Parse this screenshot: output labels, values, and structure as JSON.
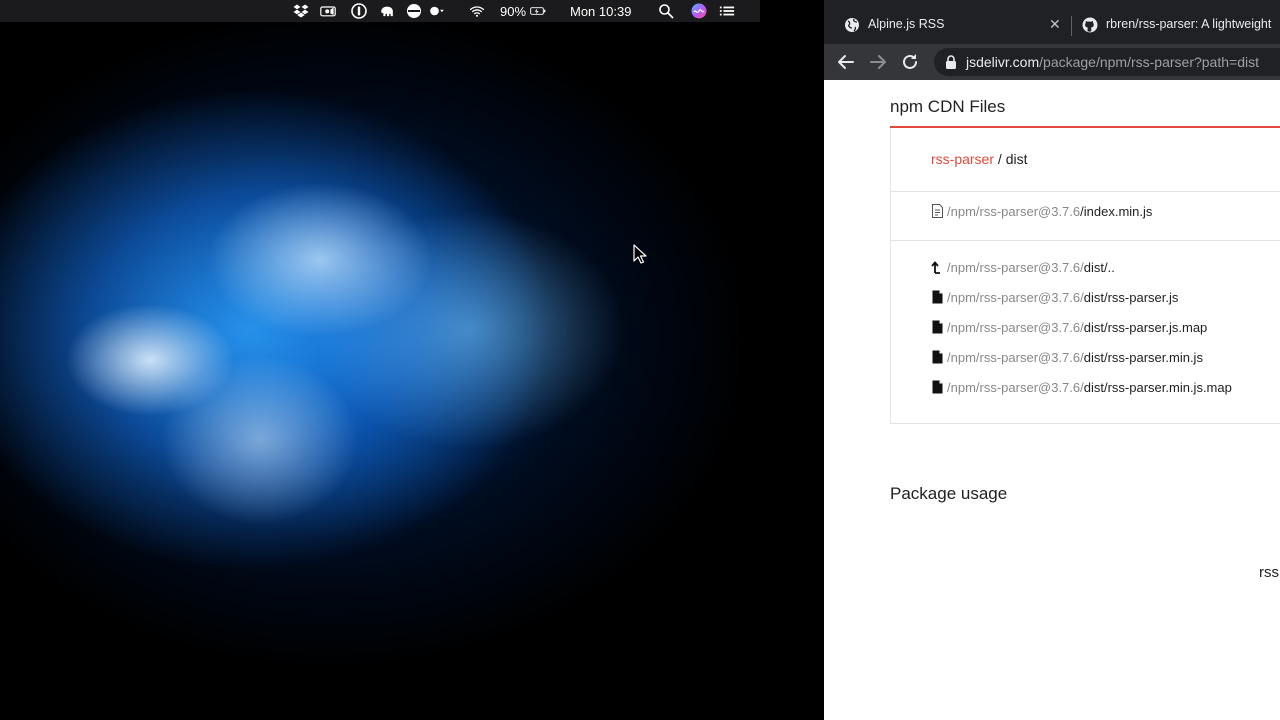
{
  "menubar": {
    "battery_percent": "90%",
    "clock": "Mon 10:39",
    "icons": [
      "dropbox-icon",
      "screen-record-icon",
      "onepassword-icon",
      "elephant-icon",
      "bartender-icon",
      "moon-icon",
      "wifi-icon",
      "battery-charging-icon",
      "search-icon",
      "siri-icon",
      "control-list-icon"
    ]
  },
  "browser": {
    "tabs": [
      {
        "title": "Alpine.js RSS",
        "favicon": "globe-icon",
        "active": true
      },
      {
        "title": "rbren/rss-parser: A lightweight",
        "favicon": "github-icon",
        "active": false
      }
    ],
    "url_host": "jsdelivr.com",
    "url_path": "/package/npm/rss-parser?path=dist"
  },
  "page": {
    "files_title": "npm CDN Files",
    "breadcrumb": {
      "package": "rss-parser",
      "separator": " / ",
      "folder": "dist"
    },
    "default_file": {
      "prefix": "/npm/rss-parser@3.7.6",
      "name": "/index.min.js"
    },
    "files": [
      {
        "icon": "parent-dir-icon",
        "prefix": "/npm/rss-parser@3.7.6/",
        "name": "dist/.."
      },
      {
        "icon": "file-icon",
        "prefix": "/npm/rss-parser@3.7.6/",
        "name": "dist/rss-parser.js"
      },
      {
        "icon": "file-icon",
        "prefix": "/npm/rss-parser@3.7.6/",
        "name": "dist/rss-parser.js.map"
      },
      {
        "icon": "file-icon",
        "prefix": "/npm/rss-parser@3.7.6/",
        "name": "dist/rss-parser.min.js"
      },
      {
        "icon": "file-icon",
        "prefix": "/npm/rss-parser@3.7.6/",
        "name": "dist/rss-parser.min.js.map"
      }
    ],
    "usage_title": "Package usage",
    "usage_fragment": "rss"
  },
  "colors": {
    "accent_red": "#e14a3b",
    "tabbar": "#202124",
    "toolbar": "#35363a"
  }
}
